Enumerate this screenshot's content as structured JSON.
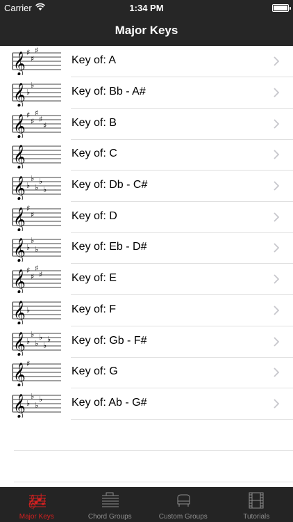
{
  "status_bar": {
    "carrier": "Carrier",
    "time": "1:34 PM",
    "battery_level": 1.0
  },
  "nav_bar": {
    "title": "Major Keys"
  },
  "keys": [
    {
      "label": "Key of: A",
      "accidental": "sharp",
      "count": 3
    },
    {
      "label": "Key of: Bb - A#",
      "accidental": "flat",
      "count": 2
    },
    {
      "label": "Key of: B",
      "accidental": "sharp",
      "count": 5
    },
    {
      "label": "Key of: C",
      "accidental": "none",
      "count": 0
    },
    {
      "label": "Key of: Db - C#",
      "accidental": "flat",
      "count": 5
    },
    {
      "label": "Key of: D",
      "accidental": "sharp",
      "count": 2
    },
    {
      "label": "Key of: Eb - D#",
      "accidental": "flat",
      "count": 3
    },
    {
      "label": "Key of: E",
      "accidental": "sharp",
      "count": 4
    },
    {
      "label": "Key of: F",
      "accidental": "flat",
      "count": 1
    },
    {
      "label": "Key of: Gb - F#",
      "accidental": "flat",
      "count": 6
    },
    {
      "label": "Key of: G",
      "accidental": "sharp",
      "count": 1
    },
    {
      "label": "Key of: Ab - G#",
      "accidental": "flat",
      "count": 4
    }
  ],
  "tab_bar": {
    "tabs": [
      {
        "label": "Major Keys",
        "icon": "staff-notes-icon",
        "active": true
      },
      {
        "label": "Chord Groups",
        "icon": "staff-lines-icon",
        "active": false
      },
      {
        "label": "Custom Groups",
        "icon": "piano-icon",
        "active": false
      },
      {
        "label": "Tutorials",
        "icon": "film-icon",
        "active": false
      }
    ]
  },
  "colors": {
    "bar_background": "#262626",
    "active_tab": "#d32020",
    "inactive_tab": "#8e8e8e",
    "separator": "#e0e0e0",
    "chevron": "#c7c7cc"
  }
}
